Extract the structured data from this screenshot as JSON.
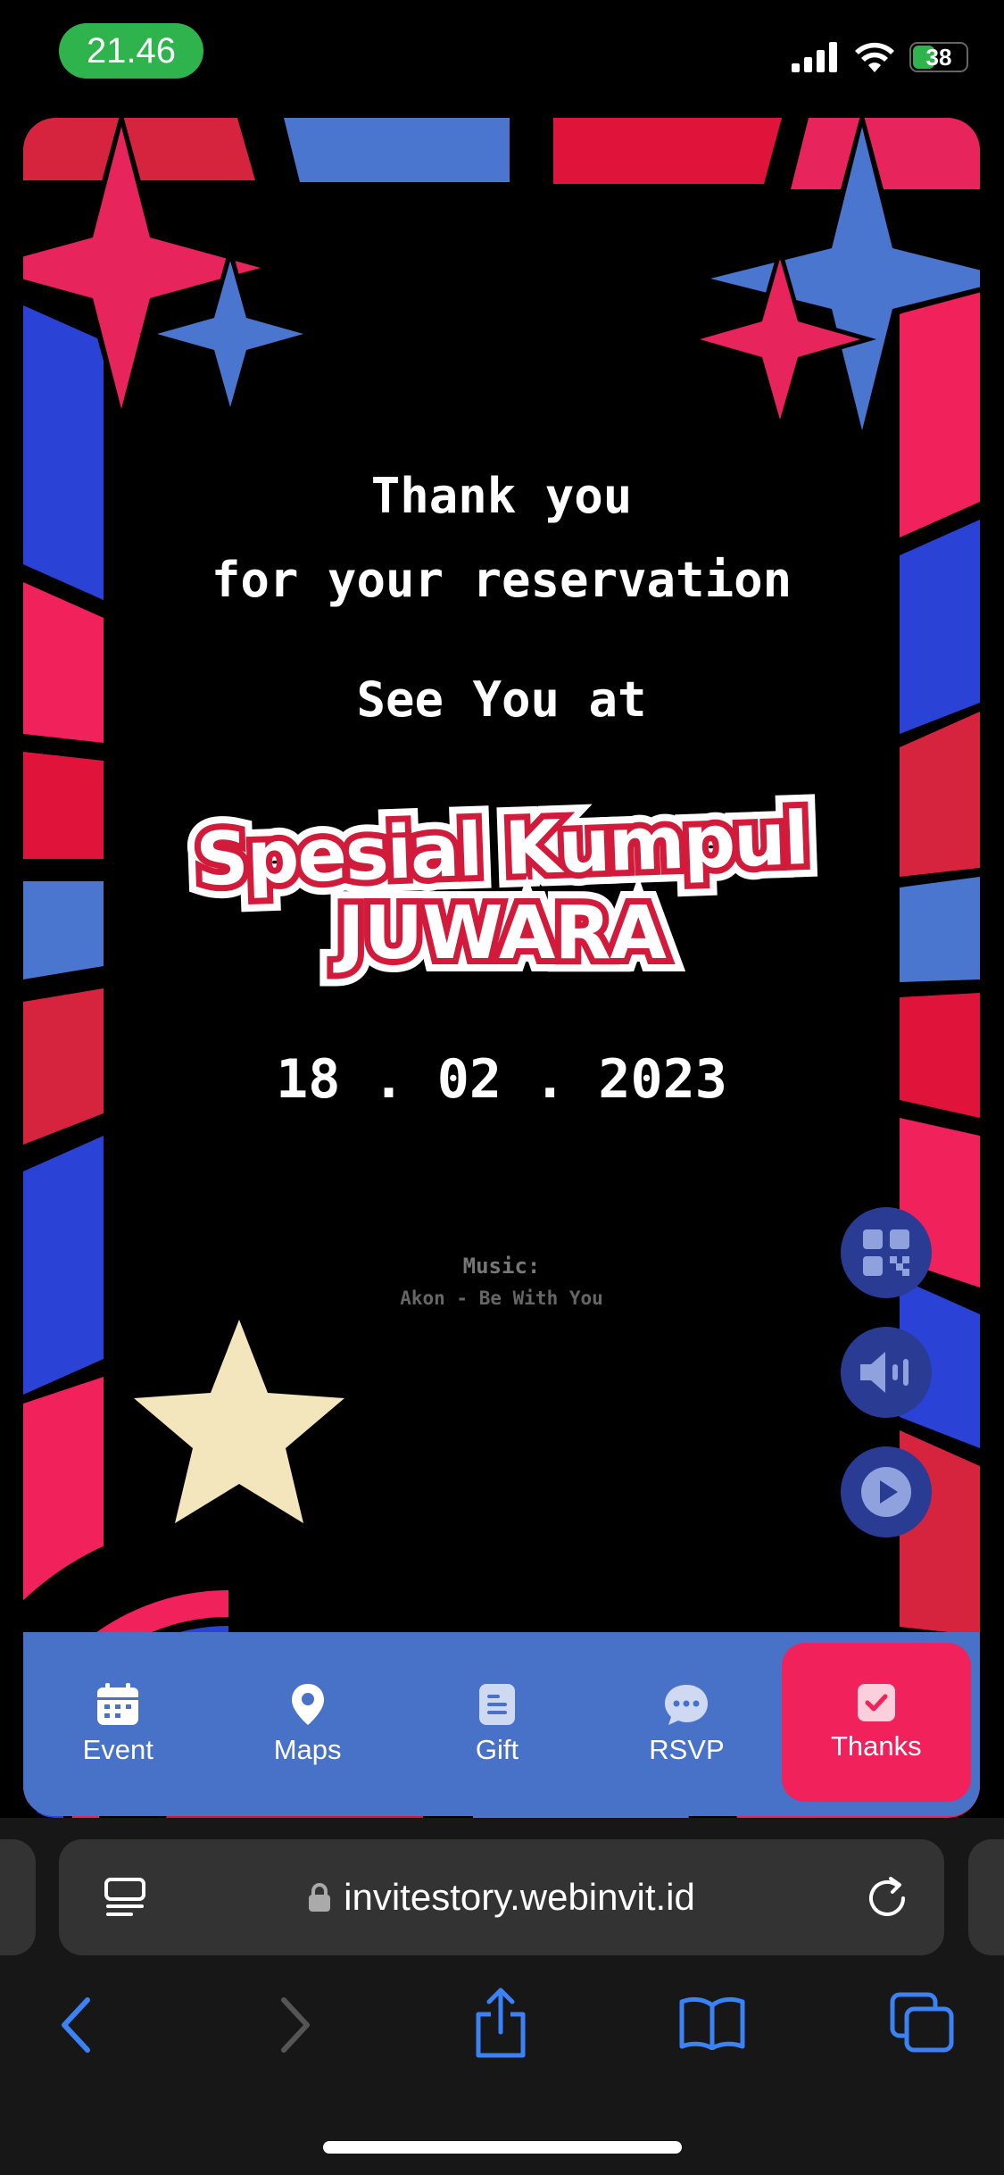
{
  "status_bar": {
    "time": "21.46",
    "battery": "38"
  },
  "card": {
    "line1": "Thank you",
    "line2": "for your reservation",
    "line3": "See You at",
    "logo_line1": "Spesial Kumpul",
    "logo_line2": "JUWARA",
    "date": "18 . 02 . 2023",
    "music_label": "Music:",
    "music_track": "Akon - Be With You"
  },
  "nav": {
    "items": [
      {
        "label": "Event",
        "icon": "calendar-icon"
      },
      {
        "label": "Maps",
        "icon": "map-pin-icon"
      },
      {
        "label": "Gift",
        "icon": "gift-list-icon"
      },
      {
        "label": "RSVP",
        "icon": "chat-bubble-icon"
      },
      {
        "label": "Thanks",
        "icon": "check-icon"
      }
    ],
    "active": "Thanks",
    "active_color": "#f0215b",
    "bar_color": "#4872c8"
  },
  "side_buttons": [
    "qr-code-icon",
    "speaker-icon",
    "play-icon"
  ],
  "browser": {
    "url": "invitestory.webinvit.id"
  },
  "colors": {
    "red": "#e5264f",
    "blue": "#3f6fd1",
    "dark_blue": "#2a3b93",
    "cream": "#f3e6bd"
  }
}
